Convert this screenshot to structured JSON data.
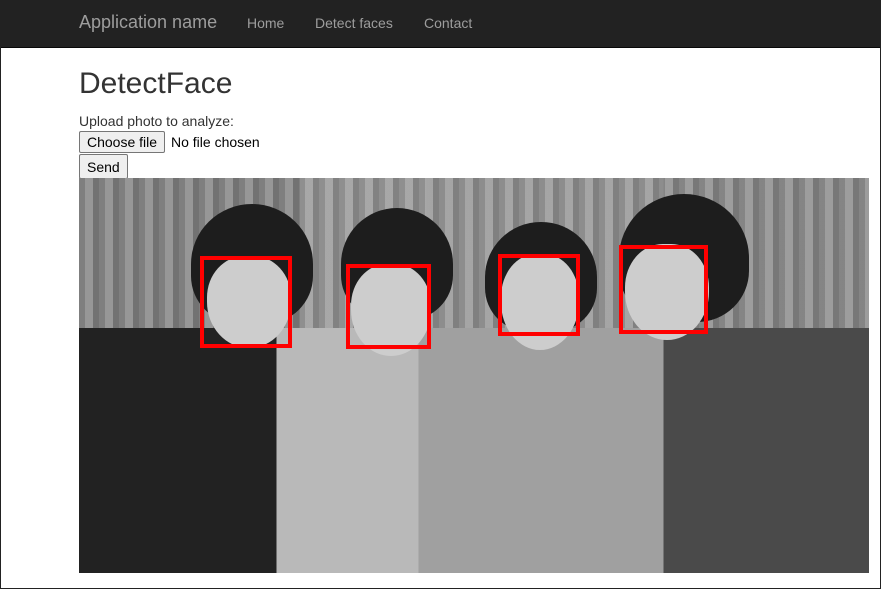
{
  "navbar": {
    "brand": "Application name",
    "links": [
      "Home",
      "Detect faces",
      "Contact"
    ]
  },
  "page": {
    "title": "DetectFace",
    "upload_label": "Upload photo to analyze:",
    "file_button": "Choose file",
    "file_status": "No file chosen",
    "send_button": "Send"
  },
  "photo": {
    "description": "Black and white group photo of four people",
    "detected_faces_count": 4,
    "box_color": "#ff0000"
  }
}
